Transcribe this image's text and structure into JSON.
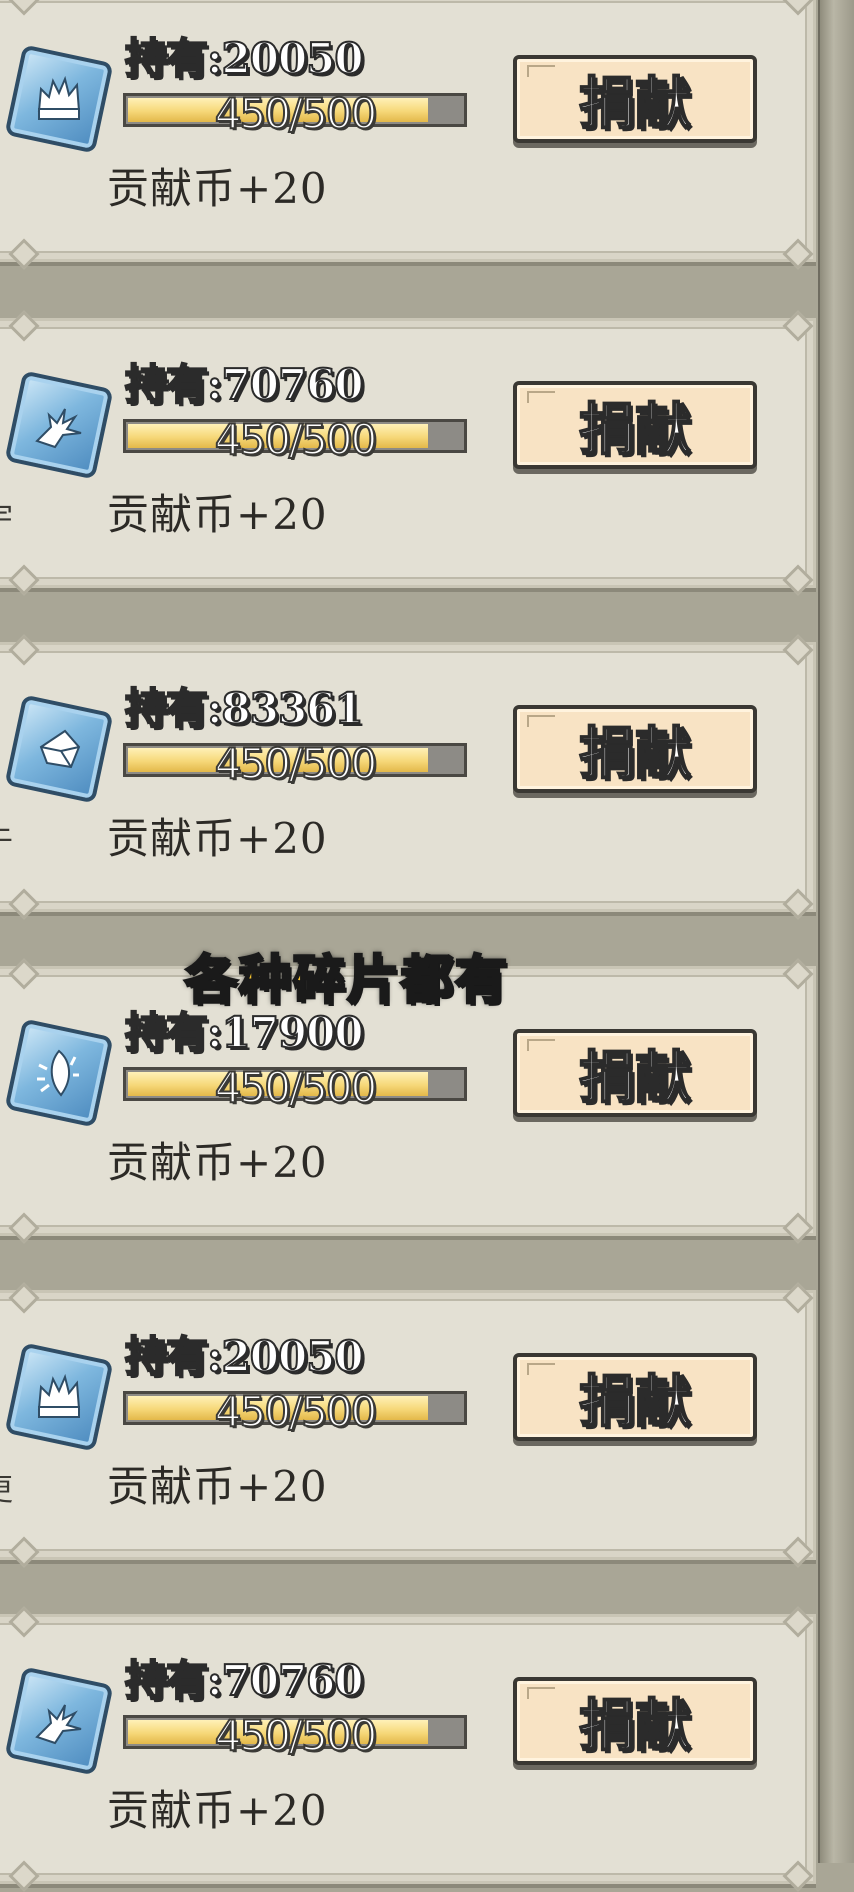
{
  "donate_label": "捐献",
  "caption": "各种碎片都有",
  "items": [
    {
      "owned": "持有:20050",
      "progress_text": "450/500",
      "progress": 0.9,
      "reward": "贡献币+20",
      "icon": "crown-shard-icon",
      "edge": ""
    },
    {
      "owned": "持有:70760",
      "progress_text": "450/500",
      "progress": 0.9,
      "reward": "贡献币+20",
      "icon": "branch-shard-icon",
      "edge": "宇"
    },
    {
      "owned": "持有:83361",
      "progress_text": "450/500",
      "progress": 0.9,
      "reward": "贡献币+20",
      "icon": "crystal-shard-icon",
      "edge": "于"
    },
    {
      "owned": "持有:17900",
      "progress_text": "450/500",
      "progress": 0.9,
      "reward": "贡献币+20",
      "icon": "ice-feather-shard-icon",
      "edge": ""
    },
    {
      "owned": "持有:20050",
      "progress_text": "450/500",
      "progress": 0.9,
      "reward": "贡献币+20",
      "icon": "crown-shard-icon",
      "edge": "更"
    },
    {
      "owned": "持有:70760",
      "progress_text": "450/500",
      "progress": 0.9,
      "reward": "贡献币+20",
      "icon": "branch-shard-icon",
      "edge": ""
    }
  ],
  "colors": {
    "button_bg": "#f8e3c4",
    "bar_fill": "#f6d879",
    "caption_text": "#f7c531",
    "panel_bg": "#e3e0d4",
    "icon_blue": "#7eb7de"
  }
}
